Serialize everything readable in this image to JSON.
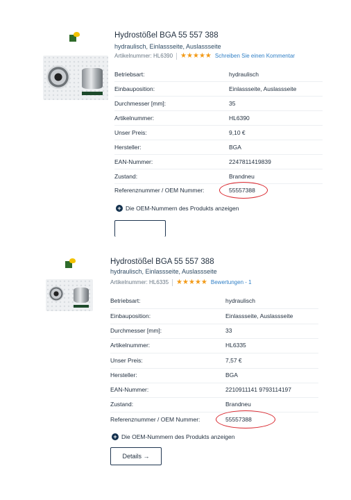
{
  "products": [
    {
      "title": "Hydrostößel BGA 55 557 388",
      "subtitle": "hydraulisch, Einlassseite, Auslassseite",
      "article_label": "Artikelnummer: HL6390",
      "rating_stars": 5,
      "review_link": "Schreiben Sie einen Kommentar",
      "specs": [
        {
          "label": "Betriebsart:",
          "value": "hydraulisch"
        },
        {
          "label": "Einbauposition:",
          "value": "Einlassseite, Auslassseite"
        },
        {
          "label": "Durchmesser [mm]:",
          "value": "35"
        },
        {
          "label": "Artikelnummer:",
          "value": "HL6390"
        },
        {
          "label": "Unser Preis:",
          "value": "9,10 €"
        },
        {
          "label": "Hersteller:",
          "value": "BGA"
        },
        {
          "label": "EAN-Nummer:",
          "value": "2247811419839"
        },
        {
          "label": "Zustand:",
          "value": "Brandneu"
        },
        {
          "label": "Referenznummer / OEM Nummer:",
          "value": "55557388"
        }
      ],
      "oem_toggle": "Die OEM-Nummern des Produkts anzeigen",
      "details_button": ""
    },
    {
      "title": "Hydrostößel BGA 55 557 388",
      "subtitle": "hydraulisch, Einlassseite, Auslassseite",
      "article_label": "Artikelnummer: HL6335",
      "rating_stars": 5,
      "review_link": "Bewertungen - 1",
      "specs": [
        {
          "label": "Betriebsart:",
          "value": "hydraulisch"
        },
        {
          "label": "Einbauposition:",
          "value": "Einlassseite, Auslassseite"
        },
        {
          "label": "Durchmesser [mm]:",
          "value": "33"
        },
        {
          "label": "Artikelnummer:",
          "value": "HL6335"
        },
        {
          "label": "Unser Preis:",
          "value": "7,57 €"
        },
        {
          "label": "Hersteller:",
          "value": "BGA"
        },
        {
          "label": "EAN-Nummer:",
          "value": "2210911141 9793114197"
        },
        {
          "label": "Zustand:",
          "value": "Brandneu"
        },
        {
          "label": "Referenznummer / OEM Nummer:",
          "value": "55557388"
        }
      ],
      "oem_toggle": "Die OEM-Nummern des Produkts anzeigen",
      "details_button": "Details →"
    }
  ],
  "colors": {
    "star": "#f29a17",
    "link": "#2f7fc6",
    "highlight_circle": "#d9232a",
    "oem_icon": "#12304d"
  },
  "icons": [
    "brand-logo-icon",
    "star-icon",
    "plus-circle-icon",
    "arrow-right-icon"
  ]
}
